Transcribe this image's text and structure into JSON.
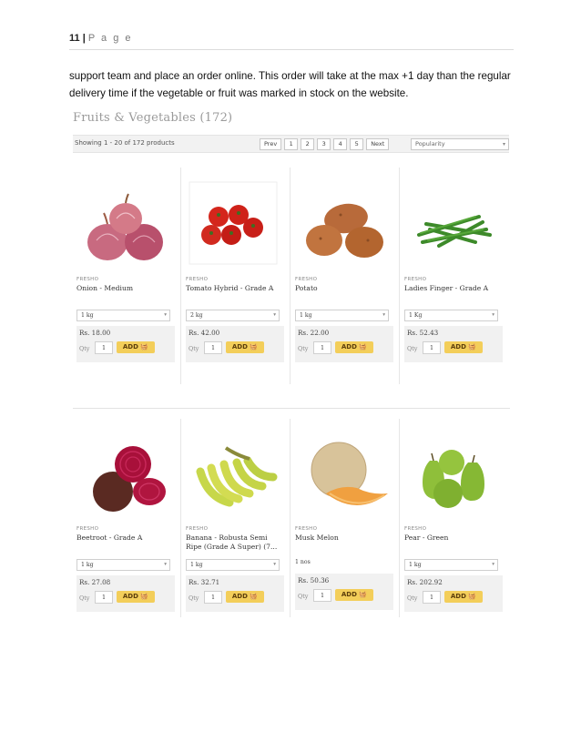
{
  "header": {
    "page_number": "11",
    "separator": "|",
    "page_label": "P a g e"
  },
  "intro_text": "support team and place an order online. This order will take at the max +1 day than the regular delivery time if the vegetable or fruit was marked in stock on the website.",
  "shop": {
    "title": "Fruits & Vegetables (172)",
    "showing": "Showing 1 - 20 of 172 products",
    "pagination": [
      "Prev",
      "1",
      "2",
      "3",
      "4",
      "5",
      "Next"
    ],
    "sort_selected": "Popularity",
    "sort_chevron": "▾",
    "qty_label": "Qty",
    "add_label": "ADD",
    "basket_icon": "basket-icon",
    "products": [
      {
        "brand": "FRESHO",
        "name": "Onion - Medium",
        "size": "1 kg",
        "price": "Rs. 18.00",
        "qty": "1",
        "icon": "onion"
      },
      {
        "brand": "FRESHO",
        "name": "Tomato Hybrid - Grade A",
        "size": "2 kg",
        "price": "Rs. 42.00",
        "qty": "1",
        "icon": "tomato"
      },
      {
        "brand": "FRESHO",
        "name": "Potato",
        "size": "1 kg",
        "price": "Rs. 22.00",
        "qty": "1",
        "icon": "potato"
      },
      {
        "brand": "FRESHO",
        "name": "Ladies Finger - Grade A",
        "size": "1 Kg",
        "price": "Rs. 52.43",
        "qty": "1",
        "icon": "okra"
      },
      {
        "brand": "FRESHO",
        "name": "Beetroot - Grade A",
        "size": "1 kg",
        "price": "Rs. 27.08",
        "qty": "1",
        "icon": "beetroot"
      },
      {
        "brand": "FRESHO",
        "name": "Banana - Robusta Semi Ripe (Grade A Super) (7...",
        "size": "1 kg",
        "price": "Rs. 32.71",
        "qty": "1",
        "icon": "banana"
      },
      {
        "brand": "FRESHO",
        "name": "Musk Melon",
        "size": "1 nos",
        "price": "Rs. 50.36",
        "qty": "1",
        "icon": "melon"
      },
      {
        "brand": "FRESHO",
        "name": "Pear - Green",
        "size": "1 kg",
        "price": "Rs. 202.92",
        "qty": "1",
        "icon": "pear"
      }
    ]
  }
}
